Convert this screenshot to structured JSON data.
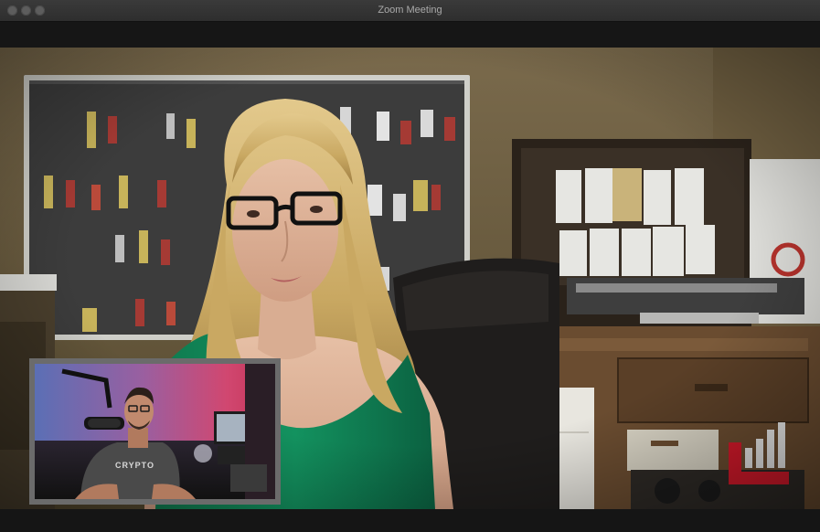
{
  "window": {
    "title": "Zoom Meeting"
  },
  "main_video": {
    "participant": "speaker-video-feed"
  },
  "self_view": {
    "shirt_text": "CRYPTO"
  },
  "watermark": {
    "brand_color": "#d3192a"
  }
}
